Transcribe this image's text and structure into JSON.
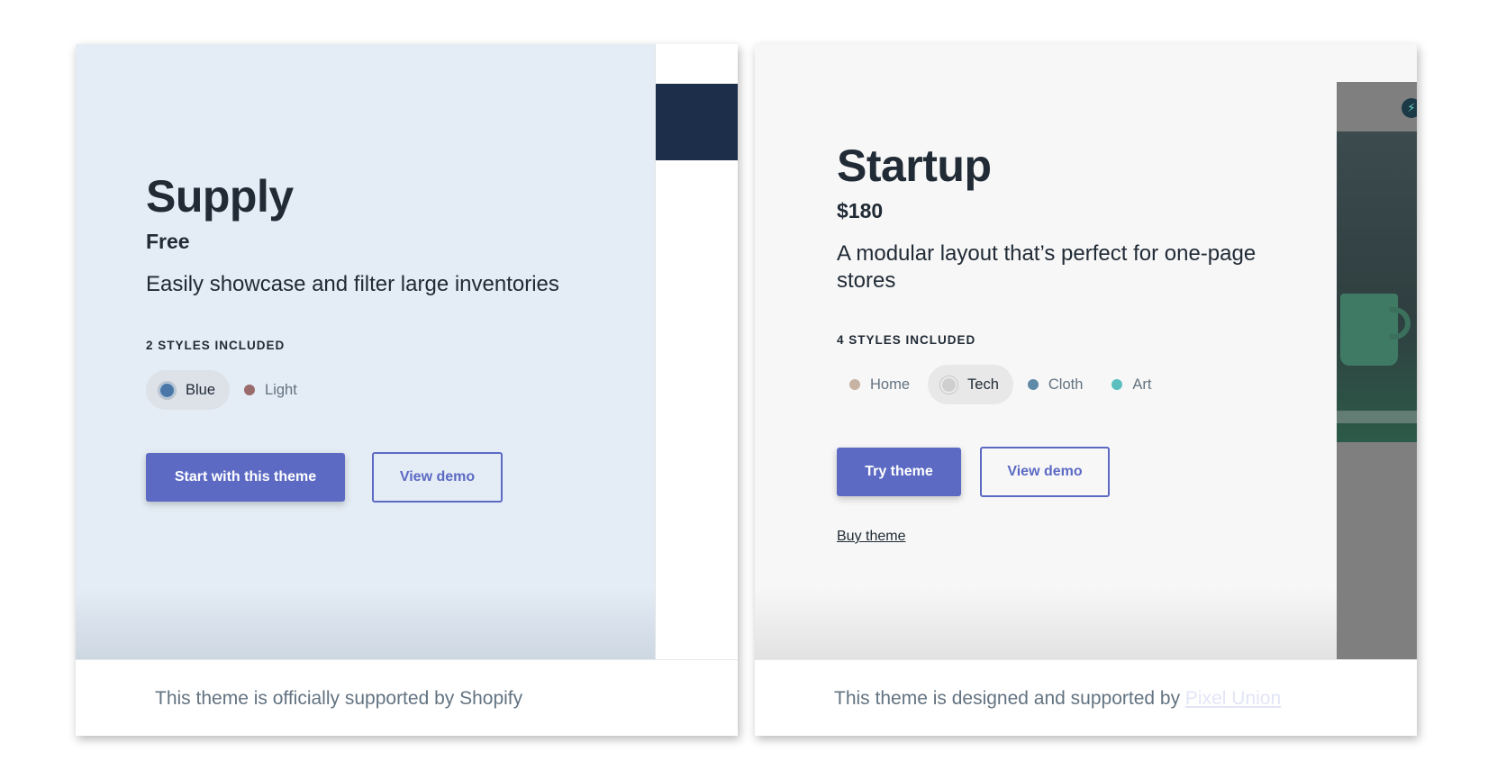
{
  "themes": [
    {
      "title": "Supply",
      "price": "Free",
      "description": "Easily showcase and filter large inventories",
      "styles_heading": "2 STYLES INCLUDED",
      "styles": [
        {
          "label": "Blue",
          "color": "#4a77a8",
          "active": true
        },
        {
          "label": "Light",
          "color": "#9a6b6a",
          "active": false
        }
      ],
      "primary_button": "Start with this theme",
      "secondary_button": "View demo",
      "footer_text": "This theme is officially supported by Shopify"
    },
    {
      "title": "Startup",
      "price": "$180",
      "description": "A modular layout that’s perfect for one-page stores",
      "styles_heading": "4 STYLES INCLUDED",
      "styles": [
        {
          "label": "Home",
          "color": "#c7b3a4",
          "active": false
        },
        {
          "label": "Tech",
          "color": "#cfcfcf",
          "active": true
        },
        {
          "label": "Cloth",
          "color": "#5f8aa8",
          "active": false
        },
        {
          "label": "Art",
          "color": "#5bbfc0",
          "active": false
        }
      ],
      "primary_button": "Try theme",
      "secondary_button": "View demo",
      "buy_link": "Buy theme",
      "footer_text": "This theme is designed and supported by",
      "footer_link": "Pixel Union"
    }
  ],
  "colors": {
    "accent": "#5c6ac4",
    "text": "#212b36",
    "muted": "#637381"
  }
}
